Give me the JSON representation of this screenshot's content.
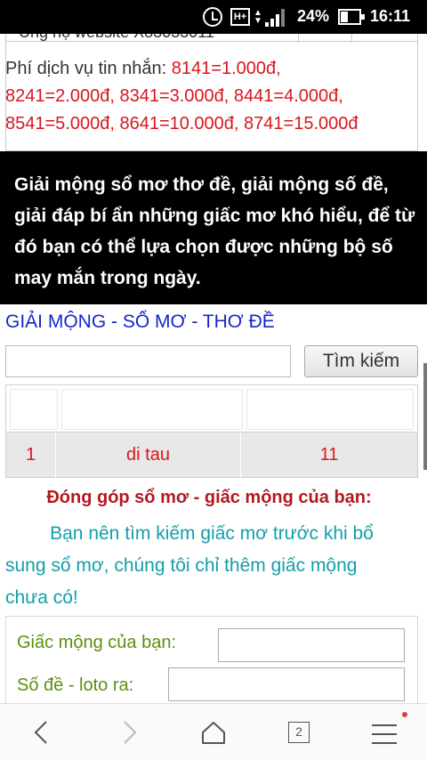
{
  "status_bar": {
    "network_label": "H+",
    "battery_percent": "24%",
    "time": "16:11",
    "icons": [
      "alarm-icon",
      "network-type-icon",
      "data-arrows-icon",
      "signal-icon",
      "battery-icon"
    ],
    "battery_level": 0.24
  },
  "info_box": {
    "service_label": "Phí dịch vụ tin nhắn:",
    "prices_line1": " 8141=1.000đ,",
    "prices_line2": "8241=2.000đ, 8341=3.000đ, 8441=4.000đ,",
    "prices_line3": "8541=5.000đ, 8641=10.000đ, 8741=15.000đ"
  },
  "intro": {
    "text": "Giải mộng sổ mơ thơ đề, giải mộng số đề, giải đáp bí ẩn những giấc mơ khó hiểu, để từ đó bạn có thể lựa chọn được những bộ số may mắn trong ngày."
  },
  "search": {
    "title": "GIẢI MỘNG - SỔ MƠ - THƠ ĐỀ",
    "query": "",
    "button_label": "Tìm kiếm"
  },
  "results": {
    "rows": [
      {
        "index": "1",
        "dream": "di tau",
        "number": "11"
      }
    ]
  },
  "contribute": {
    "title": "Đóng góp sổ mơ - giấc mộng của bạn:",
    "note_line1": "Bạn nên tìm kiếm giấc mơ trước khi bổ",
    "note_line2": "sung sổ mơ, chúng tôi chỉ thêm giấc mộng",
    "note_line3": "chưa có!",
    "dream_label": "Giấc mộng của bạn:",
    "dream_value": "",
    "number_label": "Số đề - loto ra:",
    "number_value": ""
  },
  "nav": {
    "tab_count": "2",
    "icons": [
      "back-icon",
      "forward-icon",
      "home-icon",
      "tabs-icon",
      "menu-icon"
    ]
  },
  "colors": {
    "price_red": "#d9161e",
    "title_blue": "#1627c8",
    "contrib_title": "#b3191f",
    "note_teal": "#139fa8",
    "label_green": "#5c8f13"
  }
}
